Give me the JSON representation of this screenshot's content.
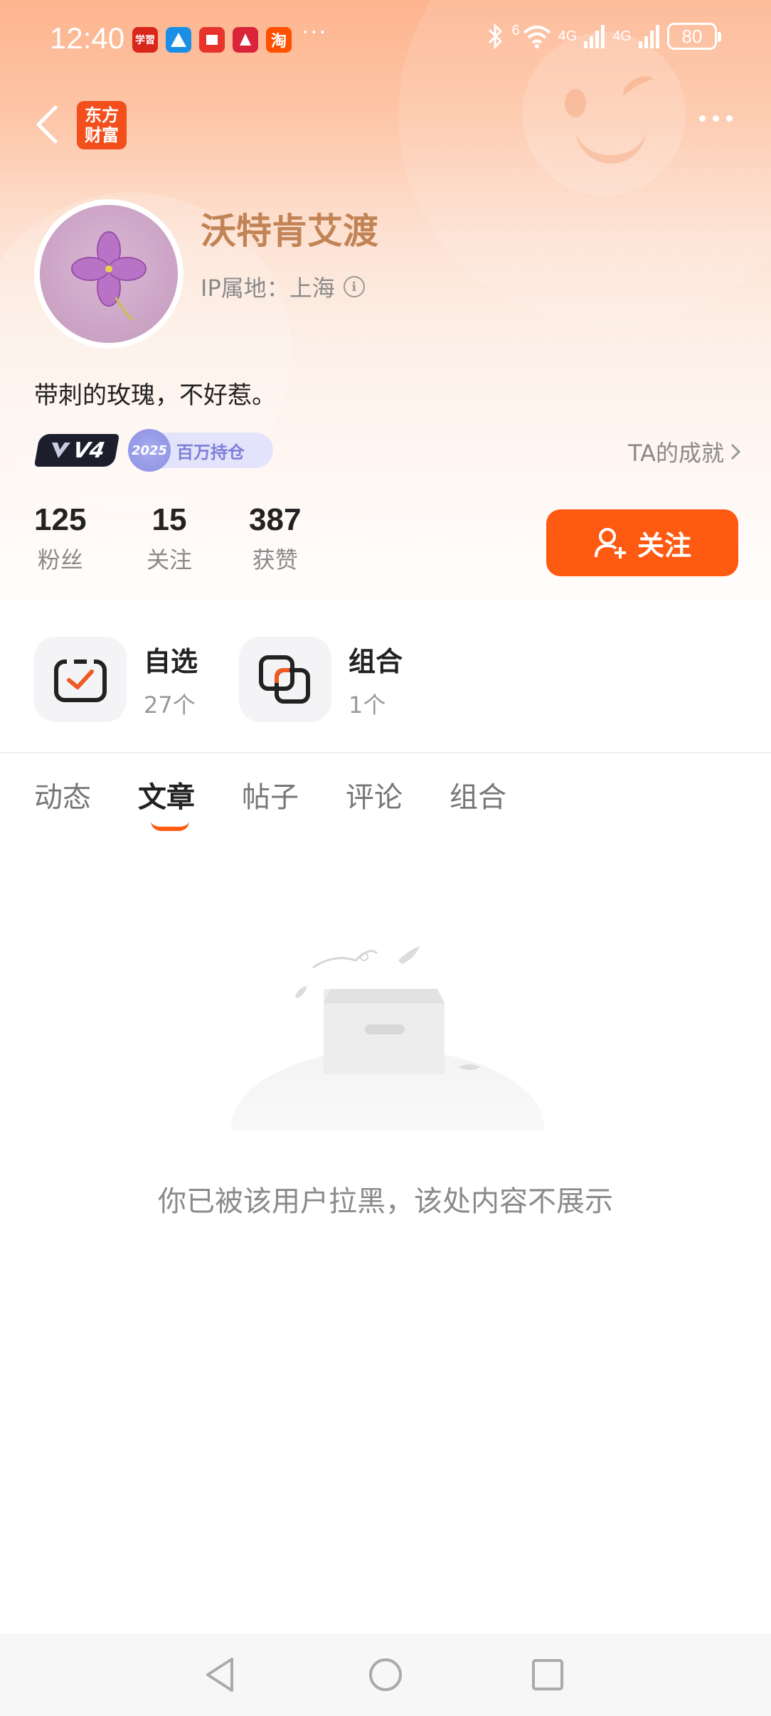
{
  "status_bar": {
    "time": "12:40",
    "notif_more": "···",
    "network_1": "4G",
    "network_2": "4G",
    "wifi_badge": "6",
    "battery": "80",
    "notif_icons": [
      {
        "name": "xuexi-app-icon",
        "color": "#d8261a",
        "text": "学習"
      },
      {
        "name": "blue-app-icon",
        "color": "#1a8fe6",
        "text": ""
      },
      {
        "name": "red-news-app-icon",
        "color": "#e8322c",
        "text": ""
      },
      {
        "name": "red-app-icon",
        "color": "#d9243a",
        "text": ""
      },
      {
        "name": "taobao-app-icon",
        "color": "#ff5000",
        "text": "淘"
      }
    ]
  },
  "nav": {
    "app_logo": "东方财富"
  },
  "profile": {
    "username": "沃特肯艾渡",
    "ip_location": "IP属地：上海",
    "bio": "带刺的玫瑰，不好惹。",
    "badge_level": "V4",
    "badge_year": "2025",
    "badge_title": "百万持仓",
    "achievements": "TA的成就"
  },
  "stats": [
    {
      "value": "125",
      "label": "粉丝"
    },
    {
      "value": "15",
      "label": "关注"
    },
    {
      "value": "387",
      "label": "获赞"
    }
  ],
  "follow_button": "关注",
  "shortcuts": [
    {
      "title": "自选",
      "sub": "27个"
    },
    {
      "title": "组合",
      "sub": "1个"
    }
  ],
  "tabs": [
    {
      "label": "动态",
      "active": false
    },
    {
      "label": "文章",
      "active": true
    },
    {
      "label": "帖子",
      "active": false
    },
    {
      "label": "评论",
      "active": false
    },
    {
      "label": "组合",
      "active": false
    }
  ],
  "empty_message": "你已被该用户拉黑，该处内容不展示",
  "colors": {
    "accent": "#ff5a12",
    "username": "#c28456",
    "badge_purple": "#7e7fd8"
  }
}
